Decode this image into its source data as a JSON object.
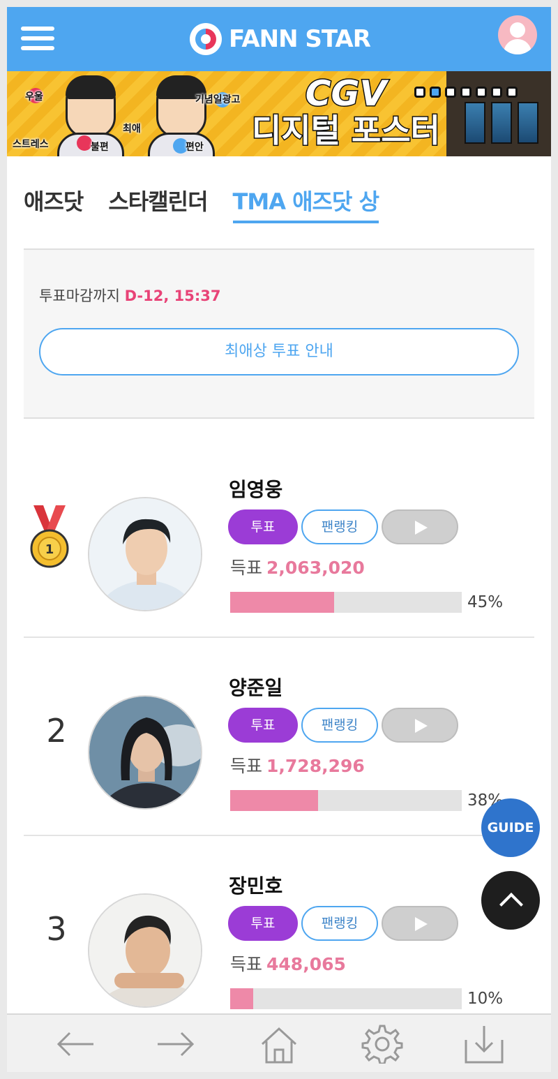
{
  "header": {
    "brand": "FANN STAR",
    "menu_icon": "hamburger-menu-icon",
    "profile_icon": "user-avatar-icon",
    "brand_color": "#4ea6f0"
  },
  "banner": {
    "words": [
      "우울",
      "스트레스",
      "불편",
      "최애",
      "기념일광고",
      "편안"
    ],
    "title_line1": "CGV",
    "title_line2": "디지털 포스터"
  },
  "tabs": [
    {
      "label": "애즈닷",
      "active": false
    },
    {
      "label": "스타캘린더",
      "active": false
    },
    {
      "label": "TMA 애즈닷 상",
      "active": true
    }
  ],
  "info": {
    "deadline_label": "투표마감까지",
    "deadline_value": "D-12, 15:37",
    "guide_button": "최애상 투표 안내"
  },
  "ranking": [
    {
      "rank": "1",
      "medal": "gold-medal-icon",
      "name": "임영웅",
      "vote_label": "투표",
      "fanrank_label": "팬랭킹",
      "votes_label": "득표",
      "votes": "2,063,020",
      "percent": 45,
      "percent_text": "45%"
    },
    {
      "rank": "2",
      "name": "양준일",
      "vote_label": "투표",
      "fanrank_label": "팬랭킹",
      "votes_label": "득표",
      "votes": "1,728,296",
      "percent": 38,
      "percent_text": "38%"
    },
    {
      "rank": "3",
      "name": "장민호",
      "vote_label": "투표",
      "fanrank_label": "팬랭킹",
      "votes_label": "득표",
      "votes": "448,065",
      "percent": 10,
      "percent_text": "10%"
    }
  ],
  "floating": {
    "guide_label": "GUIDE",
    "top_icon": "chevron-up-icon"
  },
  "bottom_nav": [
    "back-arrow-icon",
    "forward-arrow-icon",
    "home-icon",
    "gear-icon",
    "download-icon"
  ],
  "colors": {
    "vote_button": "#9b3cd6",
    "votes_number": "#e8799c",
    "deadline": "#e84377",
    "progress_fill": "#ee89a8"
  }
}
